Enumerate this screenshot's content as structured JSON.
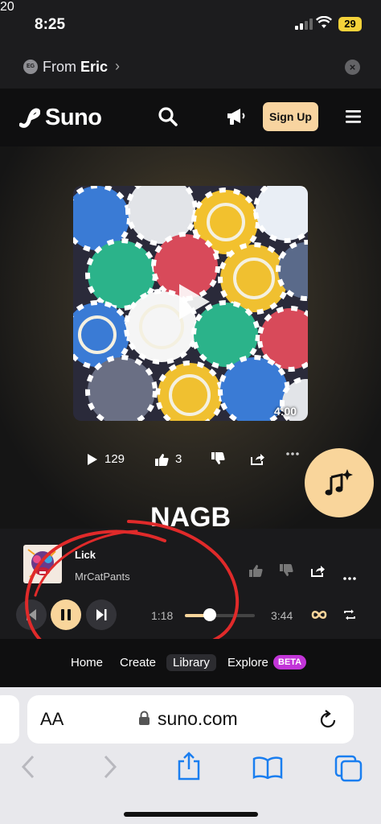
{
  "status_bar": {
    "time": "8:25",
    "battery": "29"
  },
  "back_bar": {
    "prefix": "From",
    "name": "Eric",
    "avatar_initials": "EG"
  },
  "nav": {
    "logo": "Suno",
    "notification_count": "20",
    "signup_label": "Sign Up"
  },
  "song": {
    "duration": "4:00",
    "plays": "129",
    "likes": "3",
    "title": "NAGB"
  },
  "player": {
    "track": "Lick",
    "artist": "MrCatPants",
    "elapsed": "1:18",
    "total": "3:44",
    "progress": 0.35
  },
  "tabs": [
    {
      "label": "Home"
    },
    {
      "label": "Create"
    },
    {
      "label": "Library"
    },
    {
      "label": "Explore"
    }
  ],
  "beta_label": "BETA",
  "browser": {
    "aa": "AA",
    "domain": "suno.com"
  },
  "colors": {
    "accent": "#f9d59b",
    "badge": "#e0262d",
    "beta": "#c235d8"
  }
}
